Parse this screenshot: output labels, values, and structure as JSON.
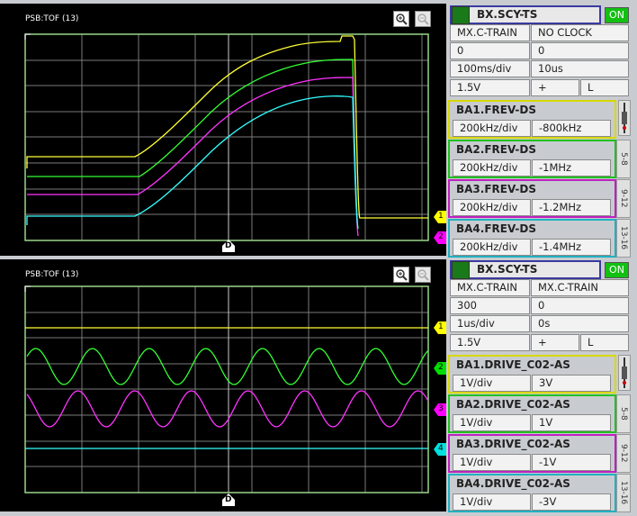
{
  "scopes": [
    {
      "title": "PSB:TOF (13)",
      "trigger_label": "D",
      "markers": [
        {
          "label": "1",
          "color": "#ffff00"
        },
        {
          "label": "2",
          "color": "#ff00ff"
        }
      ],
      "panel": {
        "header": "BX.SCY-TS",
        "on_label": "ON",
        "row1": [
          "MX.C-TRAIN",
          "NO CLOCK"
        ],
        "row2": [
          "0",
          "0"
        ],
        "row3": [
          "100ms/div",
          "10us"
        ],
        "row4": [
          "1.5V",
          "+",
          "L"
        ],
        "channels": [
          {
            "name": "BA1.FREV-DS",
            "scale": "200kHz/div",
            "offset": "-800kHz",
            "color": "#d8d800"
          },
          {
            "name": "BA2.FREV-DS",
            "scale": "200kHz/div",
            "offset": "-1MHz",
            "color": "#20c020"
          },
          {
            "name": "BA3.FREV-DS",
            "scale": "200kHz/div",
            "offset": "-1.2MHz",
            "color": "#c020c0"
          },
          {
            "name": "BA4.FREV-DS",
            "scale": "200kHz/div",
            "offset": "-1.4MHz",
            "color": "#20b0c0"
          }
        ],
        "tabs": [
          "5-8",
          "9-12",
          "13-16"
        ]
      }
    },
    {
      "title": "PSB:TOF (13)",
      "trigger_label": "D",
      "markers": [
        {
          "label": "1",
          "color": "#ffff00"
        },
        {
          "label": "2",
          "color": "#00dd00"
        },
        {
          "label": "3",
          "color": "#ff00ff"
        },
        {
          "label": "4",
          "color": "#00e0e0"
        }
      ],
      "panel": {
        "header": "BX.SCY-TS",
        "on_label": "ON",
        "row1": [
          "MX.C-TRAIN",
          "MX.C-TRAIN"
        ],
        "row2": [
          "300",
          "0"
        ],
        "row3": [
          "1us/div",
          "0s"
        ],
        "row4": [
          "1.5V",
          "+",
          "L"
        ],
        "channels": [
          {
            "name": "BA1.DRIVE_C02-AS",
            "scale": "1V/div",
            "offset": "3V",
            "color": "#d8d800"
          },
          {
            "name": "BA2.DRIVE_C02-AS",
            "scale": "1V/div",
            "offset": "1V",
            "color": "#20c020"
          },
          {
            "name": "BA3.DRIVE_C02-AS",
            "scale": "1V/div",
            "offset": "-1V",
            "color": "#c020c0"
          },
          {
            "name": "BA4.DRIVE_C02-AS",
            "scale": "1V/div",
            "offset": "-3V",
            "color": "#20b0c0"
          }
        ],
        "tabs": [
          "5-8",
          "9-12",
          "13-16"
        ]
      }
    }
  ]
}
